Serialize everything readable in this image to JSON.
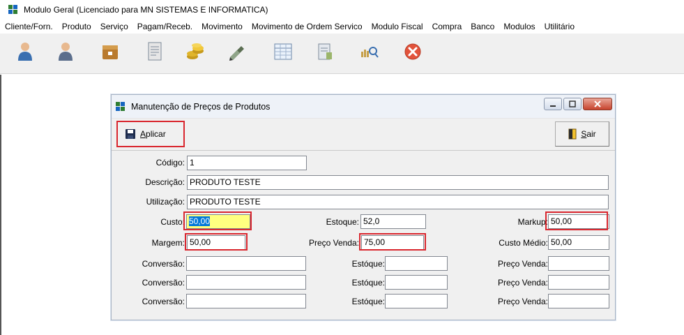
{
  "app": {
    "title": "Modulo Geral (Licenciado para MN SISTEMAS E INFORMATICA)",
    "menu": [
      "Cliente/Forn.",
      "Produto",
      "Serviço",
      "Pagam/Receb.",
      "Movimento",
      "Movimento de Ordem Servico",
      "Modulo Fiscal",
      "Compra",
      "Banco",
      "Modulos",
      "Utilitário"
    ],
    "toolbar_icons": [
      "user-icon",
      "user-icon",
      "box-icon",
      "document-icon",
      "coins-icon",
      "pen-icon",
      "table-icon",
      "report-icon",
      "search-icon",
      "exit-icon"
    ]
  },
  "window": {
    "title": "Manutenção de Preços de Produtos",
    "aplicar_label": "Aplicar",
    "aplicar_accel": "A",
    "aplicar_rest": "plicar",
    "sair_accel": "S",
    "sair_rest": "air"
  },
  "form": {
    "codigo": {
      "label": "Código:",
      "value": "1"
    },
    "descricao": {
      "label": "Descrição:",
      "value": "PRODUTO TESTE"
    },
    "utilizacao": {
      "label": "Utilização:",
      "value": "PRODUTO TESTE"
    },
    "custo": {
      "label": "Custo:",
      "value": "50,00"
    },
    "estoque": {
      "label": "Estoque:",
      "value": "52,0"
    },
    "markup": {
      "label": "Markup:",
      "value": "50,00"
    },
    "margem": {
      "label": "Margem:",
      "value": "50,00"
    },
    "preco_venda": {
      "label": "Preço Venda:",
      "value": "75,00"
    },
    "custo_medio": {
      "label": "Custo Médio:",
      "value": "50,00"
    },
    "conversao_rows": [
      {
        "conversao_label": "Conversão:",
        "conversao": "",
        "estoque_label": "Estóque:",
        "estoque": "",
        "preco_label": "Preço Venda:",
        "preco": ""
      },
      {
        "conversao_label": "Conversão:",
        "conversao": "",
        "estoque_label": "Estóque:",
        "estoque": "",
        "preco_label": "Preço Venda:",
        "preco": ""
      },
      {
        "conversao_label": "Conversão:",
        "conversao": "",
        "estoque_label": "Estóque:",
        "estoque": "",
        "preco_label": "Preço Venda:",
        "preco": ""
      }
    ]
  },
  "colors": {
    "highlight": "#d9262e",
    "selection": "#0078d7",
    "field_yellow": "#ffff80"
  }
}
